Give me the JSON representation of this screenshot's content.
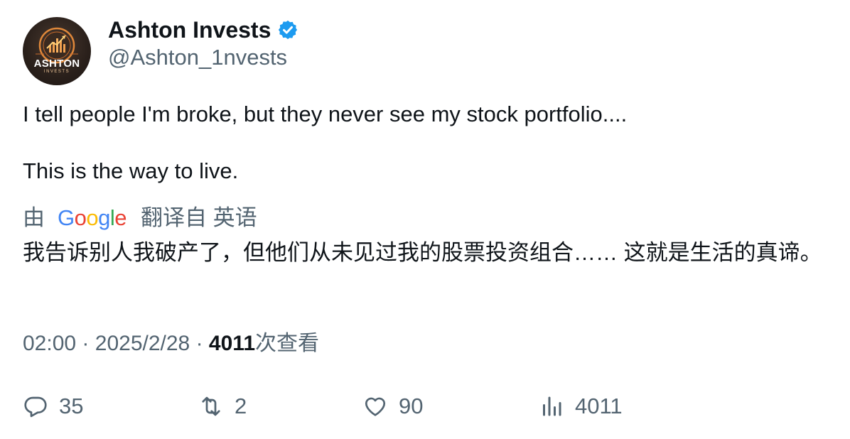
{
  "author": {
    "display_name": "Ashton Invests",
    "handle": "@Ashton_1nvests",
    "verified": true,
    "avatar_text": "ASHTON",
    "avatar_subtext": "INVESTS"
  },
  "tweet": {
    "lines": [
      "I tell people I'm broke, but they never see my stock portfolio....",
      "This is the way to live."
    ]
  },
  "translation": {
    "prefix": "由",
    "provider": "Google",
    "suffix": "翻译自 英语",
    "text": "我告诉别人我破产了，但他们从未见过我的股票投资组合…… 这就是生活的真谛。"
  },
  "meta": {
    "time": "02:00",
    "separator": "·",
    "date": "2025/2/28",
    "views": "4011",
    "views_label": "次查看"
  },
  "actions": {
    "replies": "35",
    "reposts": "2",
    "likes": "90",
    "views": "4011"
  },
  "colors": {
    "text": "#0f1419",
    "secondary": "#536471",
    "verified": "#1d9bf0"
  }
}
